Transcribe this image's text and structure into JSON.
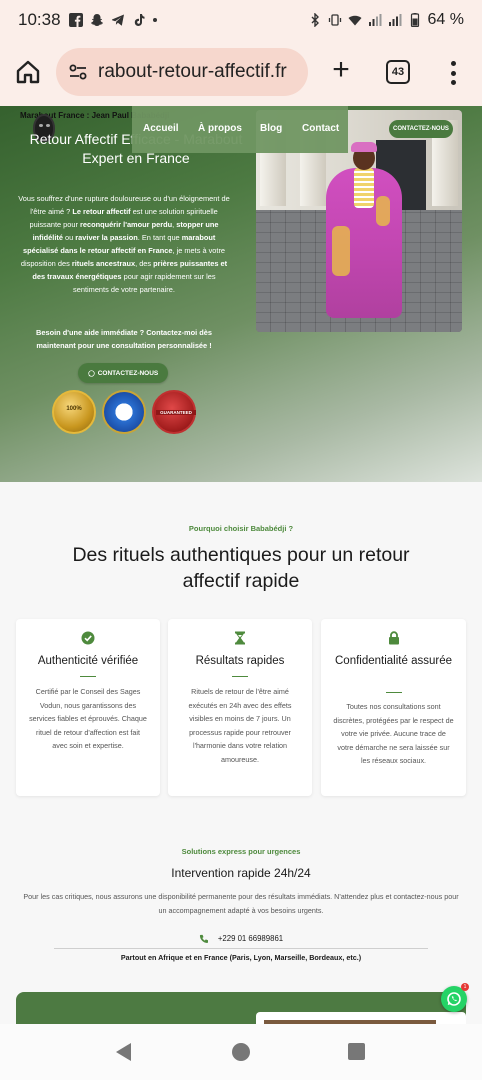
{
  "status_bar": {
    "time": "10:38",
    "battery": "64 %",
    "left_icons": [
      "facebook-icon",
      "snapchat-icon",
      "telegram-icon",
      "tiktok-icon",
      "more-dot-icon"
    ],
    "right_icons": [
      "bluetooth-icon",
      "vibrate-icon",
      "wifi-icon",
      "signal-icon",
      "signal-icon",
      "battery-icon"
    ]
  },
  "browser": {
    "url": "rabout-retour-affectif.fr",
    "tab_count": "43",
    "new_tab_glyph": "+"
  },
  "hero": {
    "ticker": "Marabout France : Jean Paul Bababédji",
    "title": "Retour Affectif Efficace - Marabout Expert en France",
    "desc_parts": {
      "p1": "Vous souffrez d'une rupture douloureuse ou d'un éloignement de l'être aimé ? ",
      "b1": "Le retour affectif",
      "p2": " est une solution spirituelle puissante pour ",
      "b2": "reconquérir l'amour perdu",
      "p3": ", ",
      "b3": "stopper une infidélité",
      "p4": " ou ",
      "b4": "raviver la passion",
      "p5": ". En tant que ",
      "b5": "marabout spécialisé dans le retour affectif en France",
      "p6": ", je mets à votre disposition des ",
      "b6": "rituels ancestraux",
      "p7": ", des ",
      "b7": "prières puissantes et des travaux énergétiques",
      "p8": " pour agir rapidement sur les sentiments de votre partenaire."
    },
    "cta_text": "Besoin d'une aide immédiate ? Contactez-moi dès maintenant pour une consultation personnalisée !",
    "cta_button": "CONTACTEZ-NOUS",
    "badge_gold_text": "100%",
    "badge_red_text": "GUARANTEED"
  },
  "nav": {
    "items": [
      "Accueil",
      "À propos",
      "Blog",
      "Contact"
    ],
    "button": "CONTACTEZ-NOUS"
  },
  "why": {
    "label": "Pourquoi choisir Bababédji ?",
    "title": "Des rituels authentiques pour un retour affectif rapide",
    "cards": [
      {
        "icon": "check-circle-icon",
        "title": "Authenticité vérifiée",
        "text": "Certifié par le Conseil des Sages Vodun, nous garantissons des services fiables et éprouvés. Chaque rituel de retour d'affection est fait avec soin et expertise."
      },
      {
        "icon": "hourglass-icon",
        "title": "Résultats rapides",
        "text": "Rituels de retour de l'être aimé exécutés en 24h avec des effets visibles en moins de 7 jours. Un processus rapide pour retrouver l'harmonie dans votre relation amoureuse."
      },
      {
        "icon": "lock-icon",
        "title": "Confidentialité assurée",
        "text": "Toutes nos consultations sont discrètes, protégées par le respect de votre vie privée. Aucune trace de votre démarche ne sera laissée sur les réseaux sociaux."
      }
    ]
  },
  "express": {
    "label": "Solutions express pour urgences",
    "title": "Intervention rapide 24h/24",
    "text": "Pour les cas critiques, nous assurons une disponibilité permanente pour des résultats immédiats. N'attendez plus et contactez-nous pour un accompagnement adapté à vos besoins urgents.",
    "phone": "+229 01 66989861",
    "areas": "Partout en Afrique et en France (Paris, Lyon, Marseille, Bordeaux, etc.)"
  },
  "whatsapp_badge": "1",
  "colors": {
    "accent_green": "#4a7a3f",
    "label_green": "#4e8a3d",
    "browser_bg": "#fbeee9",
    "url_bg": "#f6d7cd"
  }
}
